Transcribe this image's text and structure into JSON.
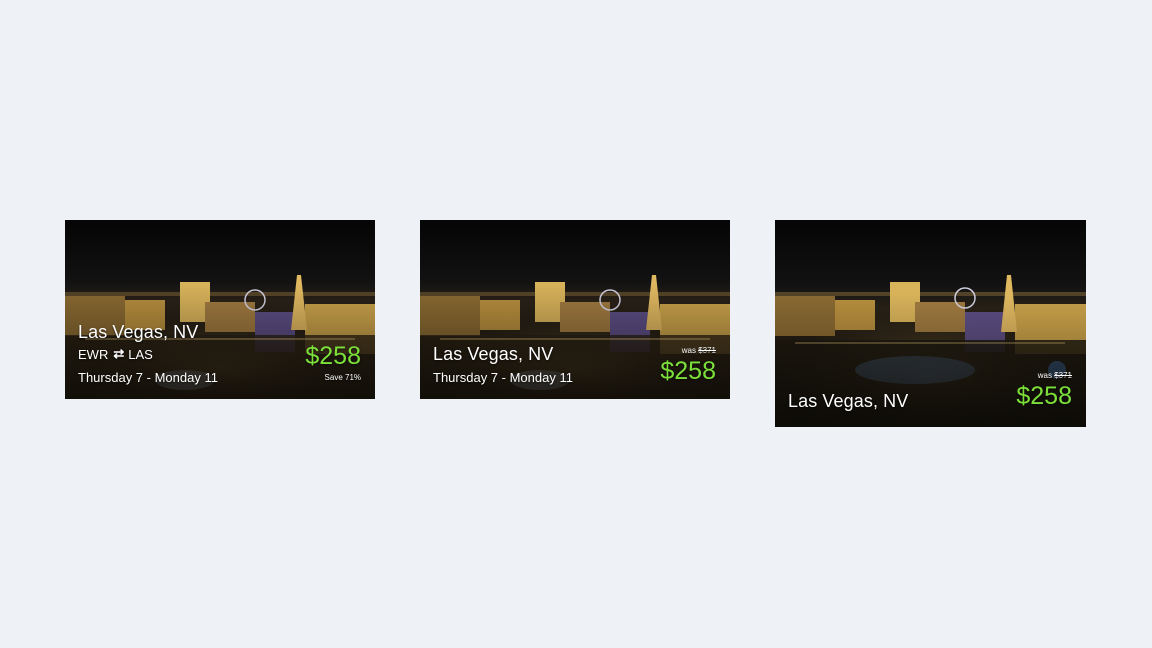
{
  "cards": [
    {
      "city": "Las Vegas, NV",
      "route": {
        "from": "EWR",
        "to": "LAS",
        "arrows": "⇄"
      },
      "dates": "Thursday 7 - Monday 11",
      "price": "$258",
      "save": "Save 71%"
    },
    {
      "city": "Las Vegas, NV",
      "dates": "Thursday 7 - Monday 11",
      "was_label": "was",
      "was_price": "$371",
      "price": "$258"
    },
    {
      "city": "Las Vegas, NV",
      "was_label": "was",
      "was_price": "$371",
      "price": "$258"
    }
  ],
  "colors": {
    "background": "#eef2f6",
    "price": "#7be03a",
    "text": "#ffffff"
  }
}
